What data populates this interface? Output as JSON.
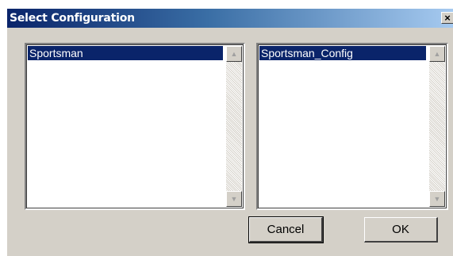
{
  "window": {
    "title": "Select Configuration",
    "close_glyph": "×"
  },
  "left_list": {
    "items": [
      {
        "label": "Sportsman",
        "selected": true
      }
    ]
  },
  "right_list": {
    "items": [
      {
        "label": "Sportsman_Config",
        "selected": true
      }
    ]
  },
  "buttons": {
    "cancel_label": "Cancel",
    "ok_label": "OK"
  },
  "icons": {
    "scroll_up": "▲",
    "scroll_down": "▼"
  },
  "colors": {
    "selection": "#0a246a",
    "dialog_face": "#d4d0c8",
    "title_gradient_start": "#0a246a",
    "title_gradient_end": "#a6caf0"
  }
}
